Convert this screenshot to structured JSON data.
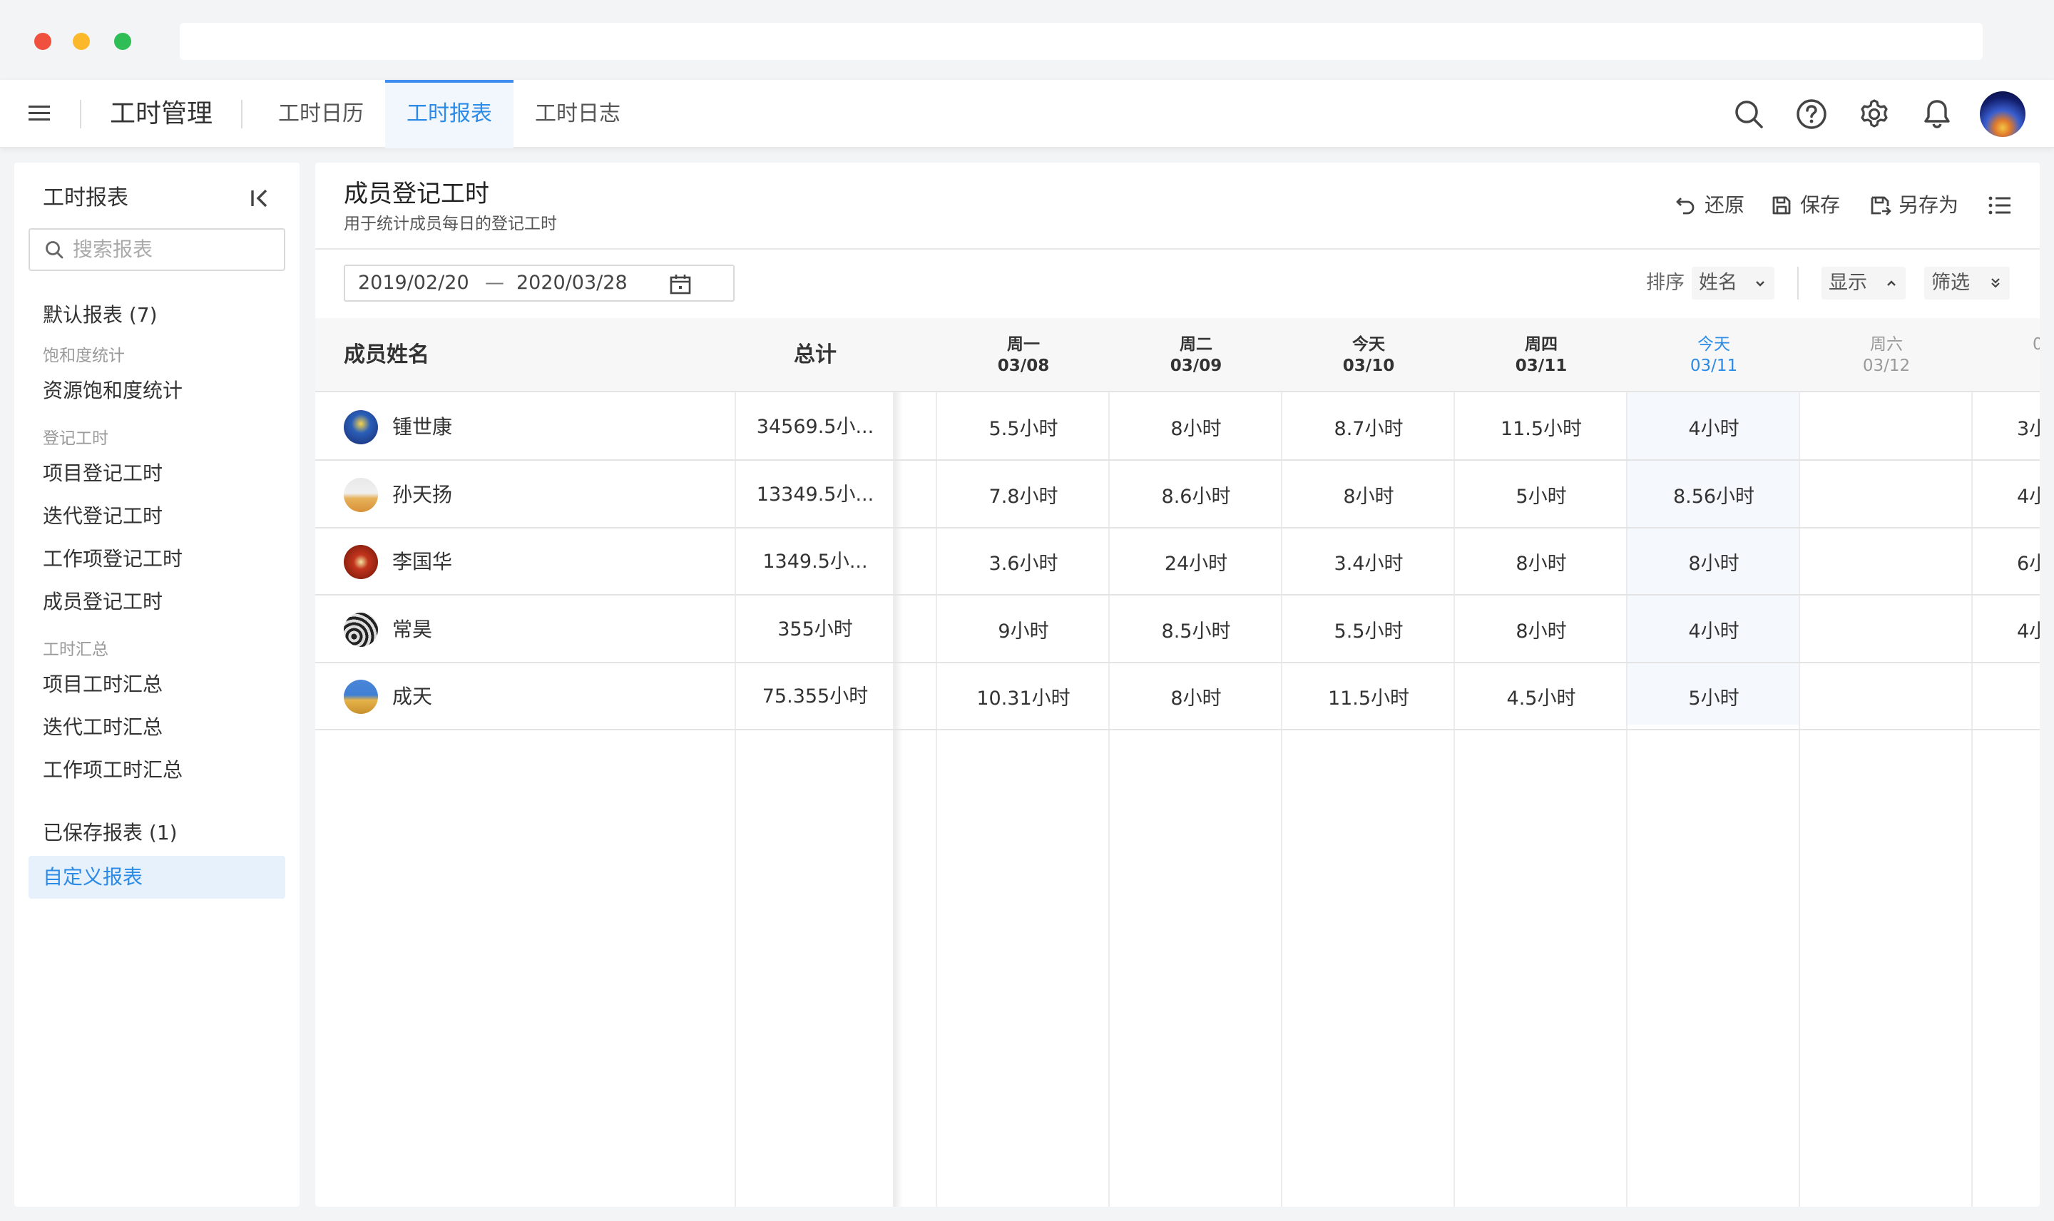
{
  "header": {
    "app_title": "工时管理",
    "tabs": [
      {
        "label": "工时日历"
      },
      {
        "label": "工时报表"
      },
      {
        "label": "工时日志"
      }
    ],
    "active_tab": 1,
    "icons": [
      "search-icon",
      "help-icon",
      "gear-icon",
      "bell-icon"
    ]
  },
  "sidebar": {
    "title": "工时报表",
    "search_placeholder": "搜索报表",
    "default_group": "默认报表 (7)",
    "subgroups": [
      {
        "label": "饱和度统计",
        "items": [
          "资源饱和度统计"
        ]
      },
      {
        "label": "登记工时",
        "items": [
          "项目登记工时",
          "迭代登记工时",
          "工作项登记工时",
          "成员登记工时"
        ]
      },
      {
        "label": "工时汇总",
        "items": [
          "项目工时汇总",
          "迭代工时汇总",
          "工作项工时汇总"
        ]
      }
    ],
    "saved_group": "已保存报表 (1)",
    "saved_items": [
      "自定义报表"
    ]
  },
  "main": {
    "title": "成员登记工时",
    "description": "用于统计成员每日的登记工时",
    "toolbar": {
      "restore": "还原",
      "save": "保存",
      "save_as": "另存为"
    },
    "date_start": "2019/02/20",
    "date_sep": "—",
    "date_end": "2020/03/28",
    "sort_label": "排序",
    "sort_value": "姓名",
    "display_label": "显示",
    "filter_label": "筛选"
  },
  "table": {
    "col_name": "成员姓名",
    "col_total": "总计",
    "days": [
      {
        "weekday": "周一",
        "date": "03/08"
      },
      {
        "weekday": "周二",
        "date": "03/09"
      },
      {
        "weekday": "今天",
        "date": "03/10"
      },
      {
        "weekday": "周四",
        "date": "03/11"
      },
      {
        "weekday": "今天",
        "date": "03/11"
      },
      {
        "weekday": "周六",
        "date": "03/12"
      },
      {
        "weekday": "",
        "date": "0"
      }
    ],
    "rows": [
      {
        "name": "锺世康",
        "total": "34569.5小...",
        "values": [
          "5.5小时",
          "8小时",
          "8.7小时",
          "11.5小时",
          "4小时",
          "",
          "3小"
        ]
      },
      {
        "name": "孙天扬",
        "total": "13349.5小...",
        "values": [
          "7.8小时",
          "8.6小时",
          "8小时",
          "5小时",
          "8.56小时",
          "",
          "4小"
        ]
      },
      {
        "name": "李国华",
        "total": "1349.5小...",
        "values": [
          "3.6小时",
          "24小时",
          "3.4小时",
          "8小时",
          "8小时",
          "",
          "6小"
        ]
      },
      {
        "name": "常昊",
        "total": "355小时",
        "values": [
          "9小时",
          "8.5小时",
          "5.5小时",
          "8小时",
          "4小时",
          "",
          "4小"
        ]
      },
      {
        "name": "成天",
        "total": "75.355小时",
        "values": [
          "10.31小时",
          "8小时",
          "11.5小时",
          "4.5小时",
          "5小时",
          "",
          ""
        ]
      }
    ]
  },
  "colors": {
    "accent": "#2b8be6",
    "today_bg": "#f5f9fd",
    "active_sidebar_bg": "#e6f1fc"
  }
}
